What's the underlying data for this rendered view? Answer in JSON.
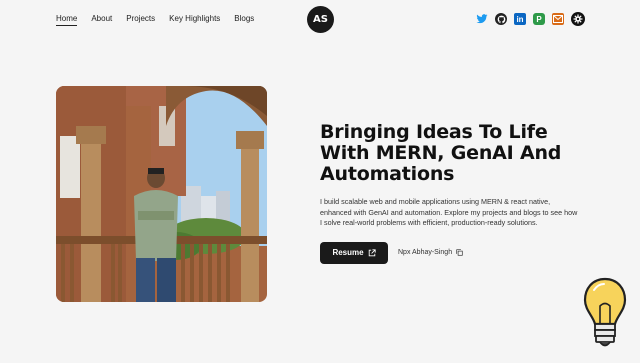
{
  "nav": {
    "items": [
      {
        "label": "Home",
        "active": true
      },
      {
        "label": "About"
      },
      {
        "label": "Projects"
      },
      {
        "label": "Key Highlights"
      },
      {
        "label": "Blogs"
      }
    ]
  },
  "logo": {
    "initials": "AS"
  },
  "socials": [
    "twitter-icon",
    "github-icon",
    "linkedin-icon",
    "peerlist-icon",
    "mail-icon",
    "settings-icon"
  ],
  "hero": {
    "title": "Bringing Ideas To Life With MERN, GenAI And Automations",
    "description": "I build scalable web and mobile applications using MERN & react native, enhanced with GenAI and automation. Explore my projects and blogs to see how I solve real-world problems with efficient, production-ready solutions.",
    "resume_label": "Resume",
    "npx_command": "Npx Abhay-Singh"
  },
  "colors": {
    "accent": "#1a1a1a",
    "background": "#f5f5f5"
  }
}
